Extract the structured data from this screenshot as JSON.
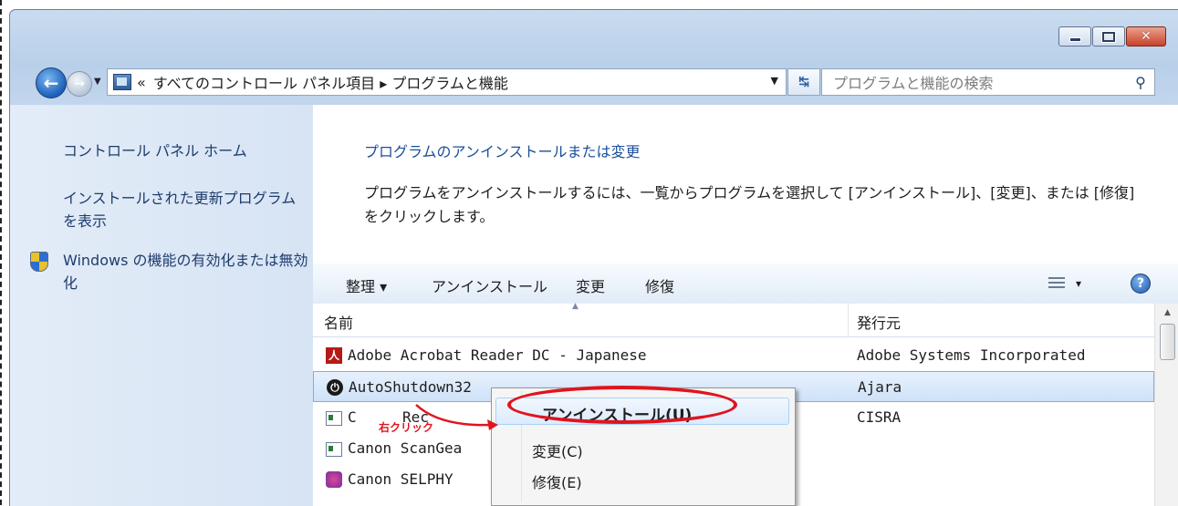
{
  "window": {
    "caption_buttons": {
      "minimize": "minimize-icon",
      "maximize": "maximize-icon",
      "close": "close-icon"
    }
  },
  "nav": {
    "address_prefix": "«",
    "address_path": "すべてのコントロール パネル項目 ▸ プログラムと機能",
    "search_placeholder": "プログラムと機能の検索"
  },
  "sidebar": {
    "items": [
      {
        "label": "コントロール パネル ホーム"
      },
      {
        "label": "インストールされた更新プログラムを表示"
      },
      {
        "label": "Windows の機能の有効化または無効化",
        "icon": "shield-icon"
      }
    ]
  },
  "main": {
    "heading": "プログラムのアンインストールまたは変更",
    "description": "プログラムをアンインストールするには、一覧からプログラムを選択して [アンインストール]、[変更]、または [修復] をクリックします。"
  },
  "toolbar": {
    "organize": "整理 ▾",
    "uninstall": "アンインストール",
    "change": "変更",
    "repair": "修復",
    "view": "▾",
    "help": "?"
  },
  "table": {
    "columns": {
      "name": "名前",
      "publisher": "発行元"
    },
    "rows": [
      {
        "name": "Adobe Acrobat Reader DC - Japanese",
        "publisher": "Adobe Systems Incorporated",
        "icon": "adobe-icon"
      },
      {
        "name": "AutoShutdown32",
        "publisher": "Ajara",
        "icon": "power-icon",
        "selected": true
      },
      {
        "name": "C",
        "name_tail": "Rec",
        "publisher": "CISRA",
        "icon": "program-icon"
      },
      {
        "name": "Canon ScanGea",
        "publisher": "",
        "icon": "program-icon"
      },
      {
        "name": "Canon SELPHY",
        "publisher": "",
        "icon": "selphy-icon"
      }
    ]
  },
  "context_menu": {
    "items": [
      {
        "label": "アンインストール(U)"
      },
      {
        "label": "変更(C)"
      },
      {
        "label": "修復(E)"
      }
    ]
  },
  "annotation": {
    "label": "右クリック",
    "color": "#e0141e"
  }
}
